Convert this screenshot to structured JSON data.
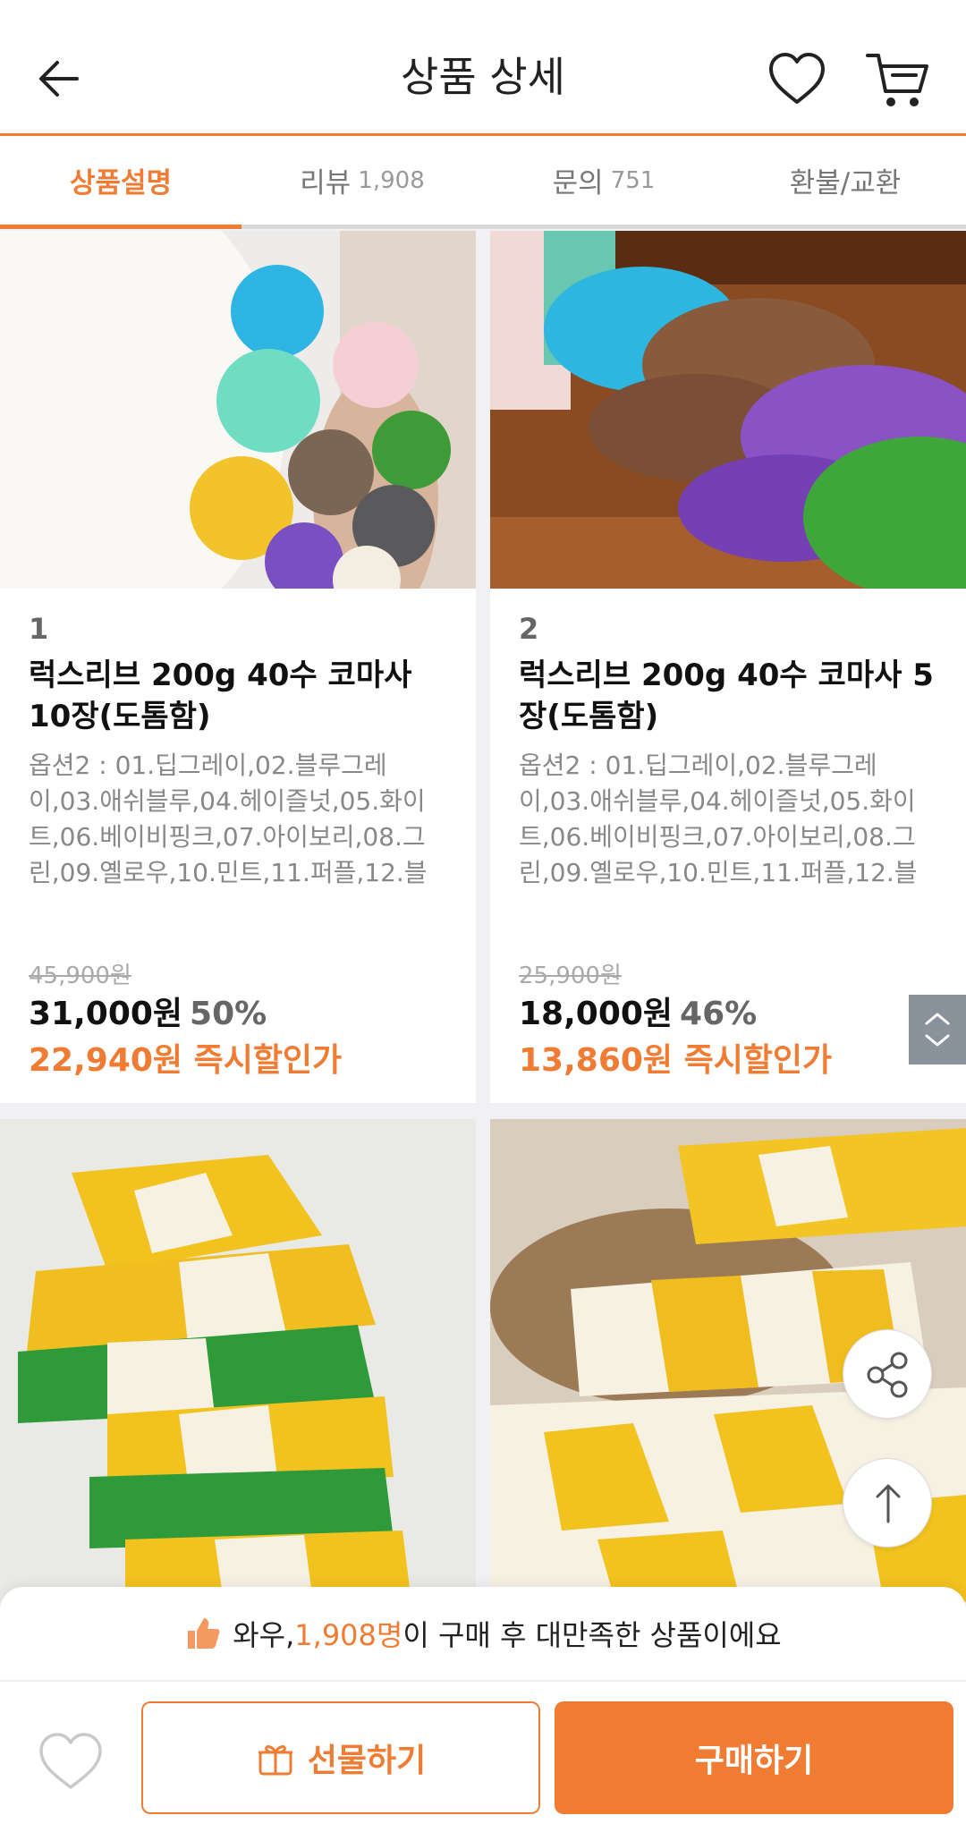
{
  "header": {
    "title": "상품 상세"
  },
  "tabs": [
    {
      "label": "상품설명",
      "count": ""
    },
    {
      "label": "리뷰",
      "count": "1,908"
    },
    {
      "label": "문의",
      "count": "751"
    },
    {
      "label": "환불/교환",
      "count": ""
    }
  ],
  "products": [
    {
      "index": "1",
      "name": "럭스리브 200g 40수 코마사 10장(도톰함)",
      "options": "옵션2 : 01.딥그레이,02.블루그레이,03.애쉬블루,04.헤이즐넛,05.화이트,06.베이비핑크,07.아이보리,08.그린,09.옐로우,10.민트,11.퍼플,12.블루...",
      "original_price": "45,900원",
      "price": "31,000원",
      "discount": "50%",
      "sale_price": "22,940원 즉시할인가"
    },
    {
      "index": "2",
      "name": "럭스리브 200g 40수 코마사 5장(도톰함)",
      "options": "옵션2 : 01.딥그레이,02.블루그레이,03.애쉬블루,04.헤이즐넛,05.화이트,06.베이비핑크,07.아이보리,08.그린,09.옐로우,10.민트,11.퍼플,12.블루...",
      "original_price": "25,900원",
      "price": "18,000원",
      "discount": "46%",
      "sale_price": "13,860원 즉시할인가"
    }
  ],
  "promo": {
    "prefix": "와우, ",
    "highlight": "1,908명",
    "suffix": "이 구매 후 대만족한 상품이에요"
  },
  "actions": {
    "gift_label": "선물하기",
    "buy_label": "구매하기"
  },
  "colors": {
    "accent": "#f07c34",
    "price_text": "#111111",
    "muted_text": "#888888"
  },
  "icons": [
    "back-arrow-icon",
    "heart-icon",
    "cart-icon",
    "share-icon",
    "arrow-up-icon",
    "thumbs-up-icon",
    "gift-icon",
    "chevron-up-icon",
    "chevron-down-icon"
  ]
}
